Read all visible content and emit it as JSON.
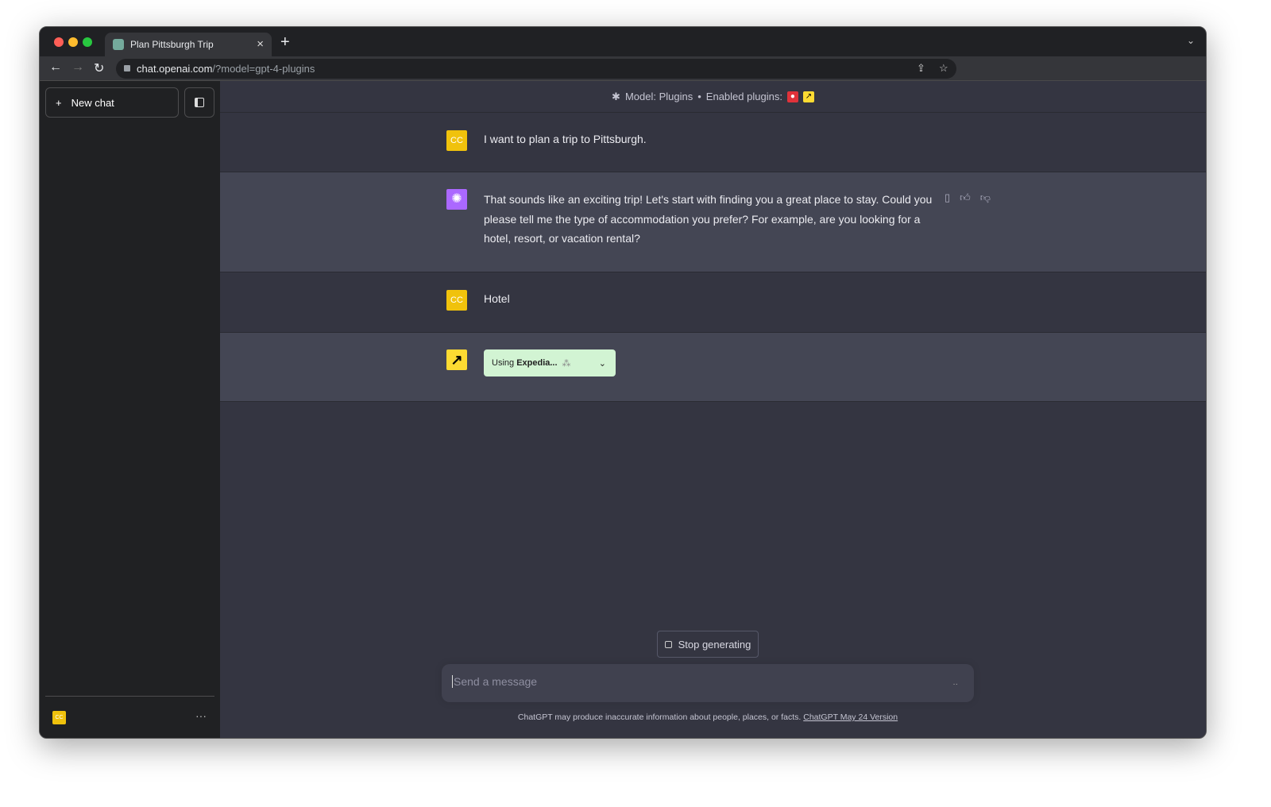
{
  "browser": {
    "tab_title": "Plan Pittsburgh Trip",
    "url_host": "chat.openai.com",
    "url_path": "/?model=gpt-4-plugins"
  },
  "sidebar": {
    "new_chat": "New chat",
    "user_initials": "CC"
  },
  "header": {
    "model": "Model: Plugins",
    "separator": "•",
    "enabled_plugins": "Enabled plugins:"
  },
  "messages": [
    {
      "role": "user",
      "initials": "CC",
      "text": "I want to plan a trip to Pittsburgh."
    },
    {
      "role": "assistant",
      "text": "That sounds like an exciting trip! Let's start with finding you a great place to stay. Could you please tell me the type of accommodation you prefer? For example, are you looking for a hotel, resort, or vacation rental?"
    },
    {
      "role": "user",
      "initials": "CC",
      "text": "Hotel"
    },
    {
      "role": "plugin",
      "using": "Using",
      "plugin_name": "Expedia..."
    }
  ],
  "stop_button": "Stop generating",
  "input": {
    "placeholder": "Send a message"
  },
  "disclaimer": {
    "text": "ChatGPT may produce inaccurate information about people, places, or facts.",
    "link": "ChatGPT May 24 Version"
  },
  "colors": {
    "user_avatar": "#f0c20c",
    "gpt_avatar": "#ab68ff",
    "plugin_box": "#d2f4d3",
    "expedia": "#fddb32",
    "plugin_red": "#e0323a"
  }
}
